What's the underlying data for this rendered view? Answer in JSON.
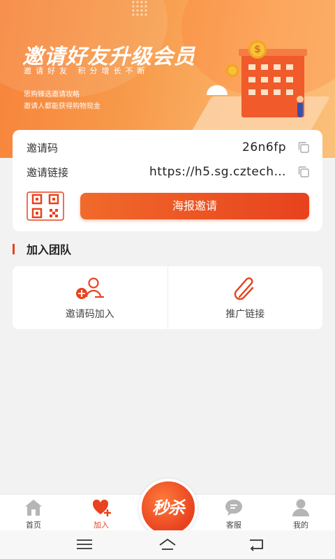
{
  "banner": {
    "title": "邀请好友升级会员",
    "subtitle": "邀请好友  积分增长不断",
    "line1": "思购臻选邀请攻略",
    "line2": "邀请人都能获得购物现金",
    "coin_symbol": "$"
  },
  "invite": {
    "code_label": "邀请码",
    "code_value": "26n6fp",
    "link_label": "邀请链接",
    "link_value": "https://h5.sg.cztech…",
    "poster_button": "海报邀请"
  },
  "team": {
    "section_title": "加入团队",
    "items": [
      {
        "label": "邀请码加入",
        "icon": "add-user-icon"
      },
      {
        "label": "推广链接",
        "icon": "paperclip-icon"
      }
    ]
  },
  "tabbar": {
    "home": "首页",
    "join": "加入",
    "seckill": "秒杀",
    "service": "客服",
    "mine": "我的"
  },
  "colors": {
    "accent": "#e8421e",
    "banner_start": "#f7833a",
    "banner_end": "#fbc07a",
    "icon_gray": "#b5b5b5"
  }
}
